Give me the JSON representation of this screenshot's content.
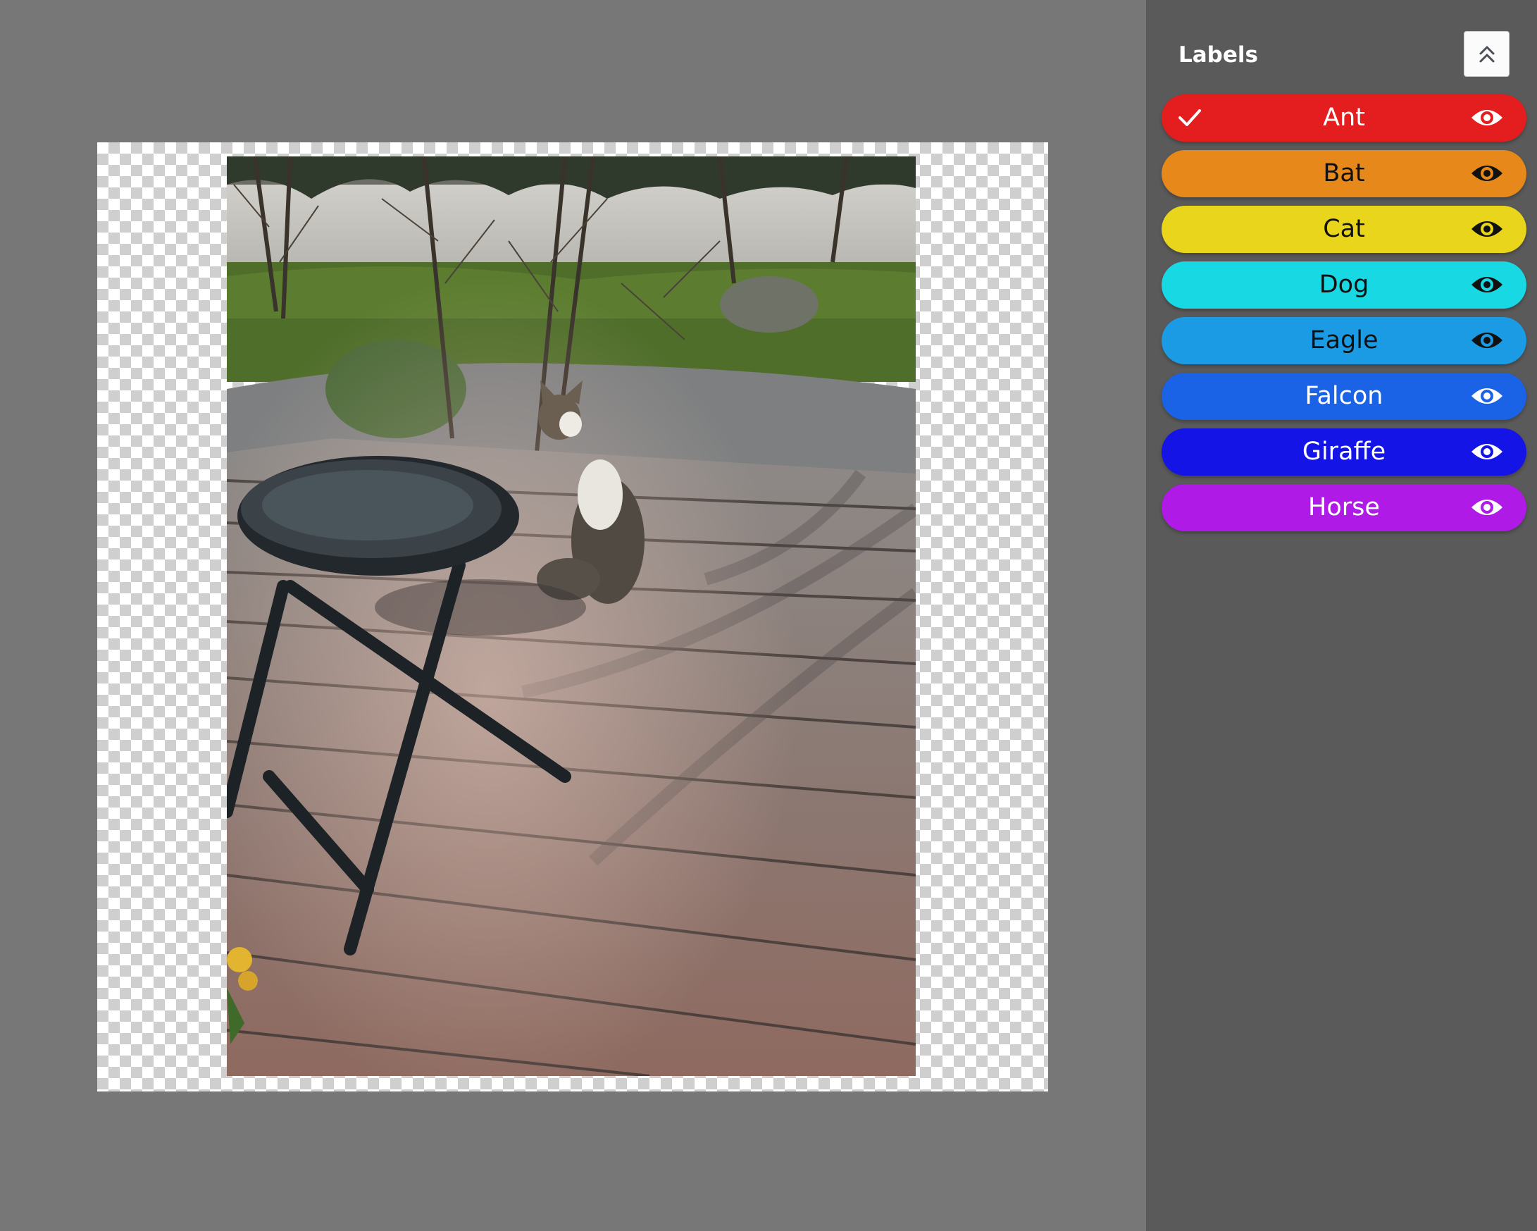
{
  "sidebar": {
    "title": "Labels",
    "collapse_icon": "double-chevron-up-icon",
    "labels": [
      {
        "name": "Ant",
        "color": "#e41e1e",
        "text_color": "#ffffff",
        "selected": true
      },
      {
        "name": "Bat",
        "color": "#e6891a",
        "text_color": "#111111",
        "selected": false
      },
      {
        "name": "Cat",
        "color": "#e8d51c",
        "text_color": "#111111",
        "selected": false
      },
      {
        "name": "Dog",
        "color": "#18d8e3",
        "text_color": "#111111",
        "selected": false
      },
      {
        "name": "Eagle",
        "color": "#1b9be3",
        "text_color": "#111111",
        "selected": false
      },
      {
        "name": "Falcon",
        "color": "#1a62e6",
        "text_color": "#ffffff",
        "selected": false
      },
      {
        "name": "Giraffe",
        "color": "#1414e6",
        "text_color": "#ffffff",
        "selected": false
      },
      {
        "name": "Horse",
        "color": "#b01ae6",
        "text_color": "#ffffff",
        "selected": false
      }
    ]
  },
  "canvas": {
    "background": "transparency-checkerboard",
    "image_subject": "photo"
  }
}
